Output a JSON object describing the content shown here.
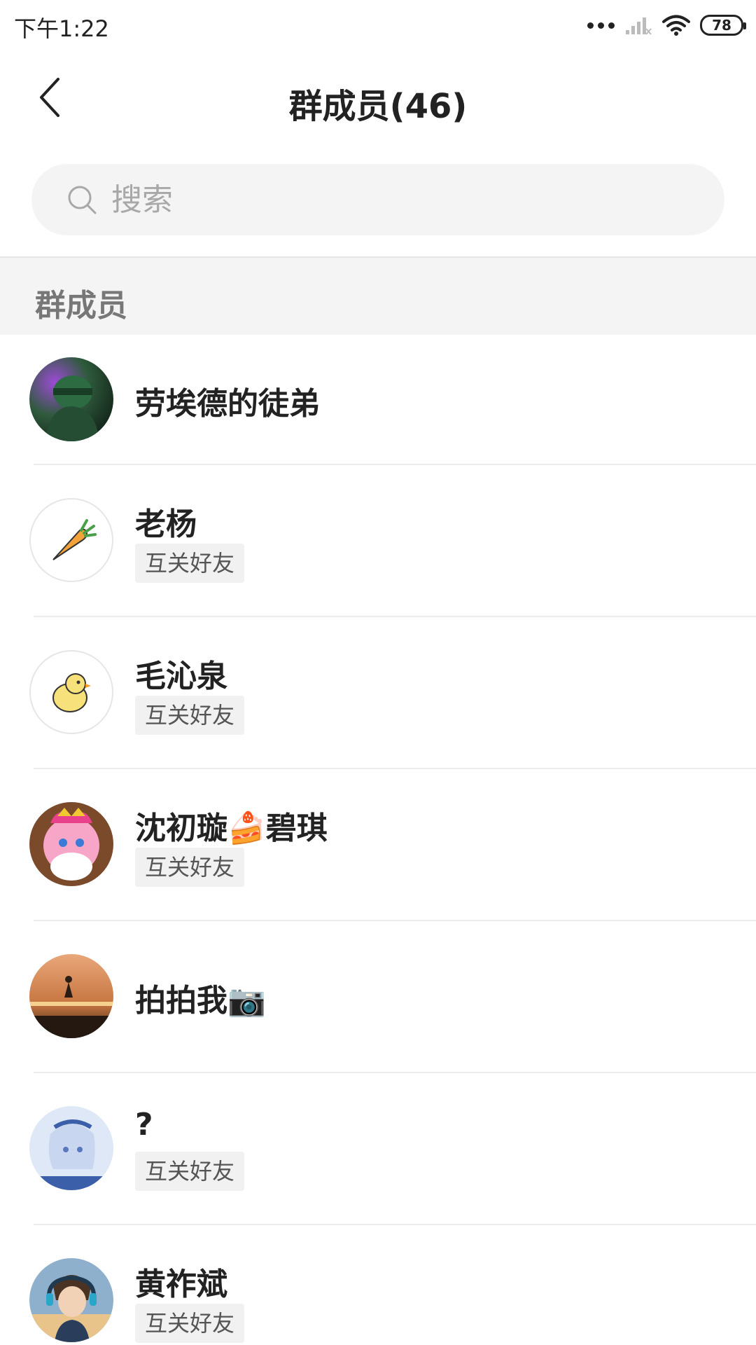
{
  "status": {
    "time": "下午1:22",
    "battery": "78"
  },
  "nav": {
    "title": "群成员(46)"
  },
  "search": {
    "placeholder": "搜索"
  },
  "section": {
    "title": "群成员"
  },
  "members": [
    {
      "name": "劳埃德的徒弟",
      "tag": ""
    },
    {
      "name": "老杨",
      "tag": "互关好友"
    },
    {
      "name": "毛沁泉",
      "tag": "互关好友"
    },
    {
      "name": "沈初璇🍰碧琪",
      "tag": "互关好友"
    },
    {
      "name": "拍拍我📷",
      "tag": ""
    },
    {
      "name": "?",
      "tag": "互关好友"
    },
    {
      "name": "黄祚斌",
      "tag": "互关好友"
    }
  ],
  "colors": {
    "background": "#ffffff",
    "section_bg": "#f4f4f4",
    "tag_bg": "#f1f1f1",
    "text": "#222222"
  }
}
